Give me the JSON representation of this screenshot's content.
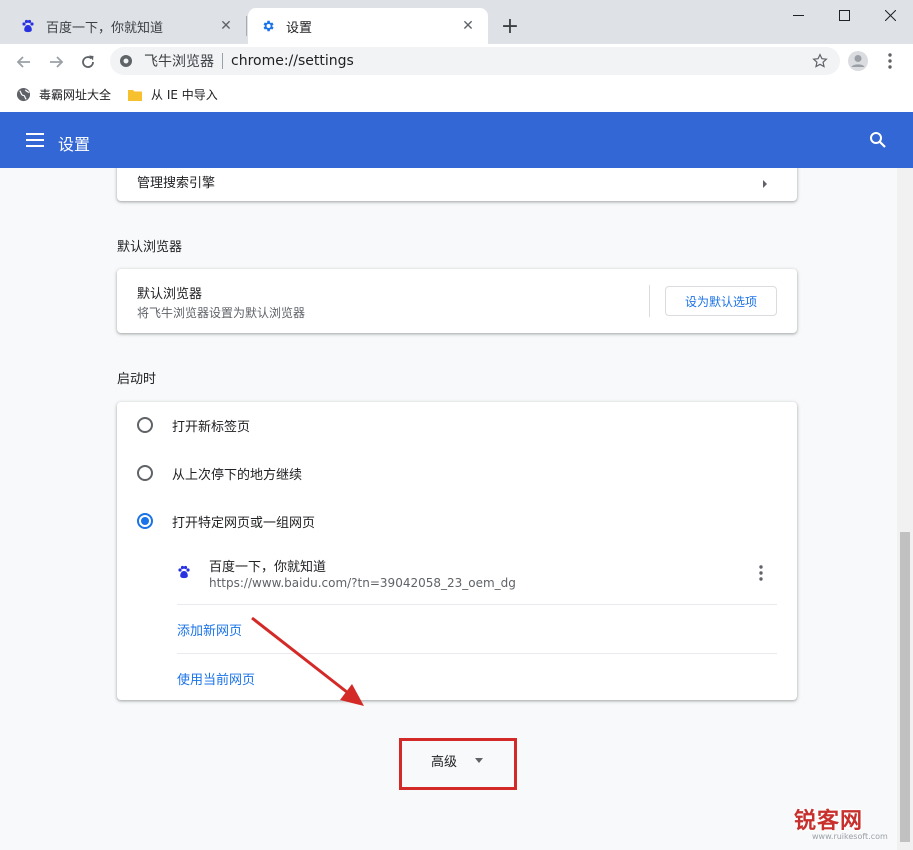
{
  "tabs": [
    {
      "title": "百度一下，你就知道",
      "icon": "baidu-paw-icon"
    },
    {
      "title": "设置",
      "icon": "gear-icon"
    }
  ],
  "omnibox": {
    "site_name": "飞牛浏览器",
    "url": "chrome://settings"
  },
  "bookmarks": [
    {
      "label": "毒霸网址大全",
      "icon": "globe-icon"
    },
    {
      "label": "从 IE 中导入",
      "icon": "folder-icon"
    }
  ],
  "header": {
    "title": "设置"
  },
  "search_engine": {
    "manage_label": "管理搜索引擎"
  },
  "default_browser": {
    "section_title": "默认浏览器",
    "primary": "默认浏览器",
    "secondary": "将飞牛浏览器设置为默认浏览器",
    "button": "设为默认选项"
  },
  "startup": {
    "section_title": "启动时",
    "options": [
      {
        "label": "打开新标签页",
        "selected": false
      },
      {
        "label": "从上次停下的地方继续",
        "selected": false
      },
      {
        "label": "打开特定网页或一组网页",
        "selected": true
      }
    ],
    "page": {
      "title": "百度一下，你就知道",
      "url": "https://www.baidu.com/?tn=39042058_23_oem_dg"
    },
    "add_page": "添加新网页",
    "use_current": "使用当前网页"
  },
  "advanced": {
    "label": "高级"
  },
  "watermark": {
    "brand": "锐客网",
    "url": "www.ruikesoft.com"
  },
  "colors": {
    "header": "#3367d6",
    "accent": "#1a73e8",
    "annotation": "#d42a27"
  }
}
